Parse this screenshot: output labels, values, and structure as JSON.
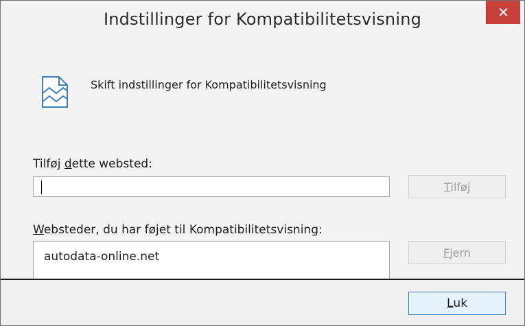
{
  "dialog": {
    "title": "Indstillinger for Kompatibilitetsvisning",
    "close_glyph": "✕",
    "heading": "Skift indstillinger for Kompatibilitetsvisning",
    "icon": "compatibility-view-icon"
  },
  "add_site": {
    "label_accel": "d",
    "label_pre": "Tilføj ",
    "label_post": "ette websted:",
    "value": "",
    "button_accel": "T",
    "button_rest": "ilføj"
  },
  "site_list": {
    "label_accel": "W",
    "label_rest": "ebsteder, du har føjet til Kompatibilitetsvisning:",
    "items": [
      "autodata-online.net"
    ],
    "button_accel": "F",
    "button_rest": "jern"
  },
  "footer": {
    "close_accel": "L",
    "close_rest": "uk"
  },
  "colors": {
    "close_button_bg": "#c8403a",
    "default_button_border": "#3c7fb1"
  }
}
